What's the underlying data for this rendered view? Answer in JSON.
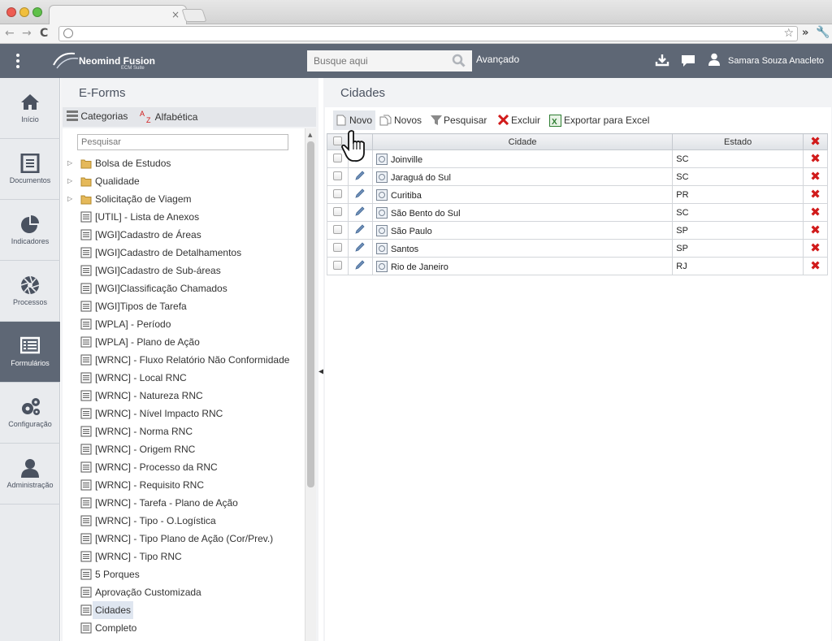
{
  "browser": {
    "tab_close": "×"
  },
  "header": {
    "logo_name": "Neomind Fusion",
    "logo_sub": "ECM Suite",
    "search_placeholder": "Busque aqui",
    "advanced_label": "Avançado",
    "user_name": "Samara Souza Anacleto"
  },
  "leftnav": {
    "items": [
      {
        "label": "Início",
        "icon": "home-icon"
      },
      {
        "label": "Documentos",
        "icon": "document-icon"
      },
      {
        "label": "Indicadores",
        "icon": "pie-chart-icon"
      },
      {
        "label": "Processos",
        "icon": "aperture-icon"
      },
      {
        "label": "Formulários",
        "icon": "form-icon",
        "active": true
      },
      {
        "label": "Configuração",
        "icon": "gears-icon"
      },
      {
        "label": "Administração",
        "icon": "user-icon"
      }
    ]
  },
  "eforms": {
    "title": "E-Forms",
    "tab_categorias": "Categorias",
    "tab_alfabetica": "Alfabética",
    "search_placeholder": "Pesquisar",
    "items": [
      {
        "label": "Bolsa de Estudos",
        "type": "folder"
      },
      {
        "label": "Qualidade",
        "type": "folder"
      },
      {
        "label": "Solicitação de Viagem",
        "type": "folder"
      },
      {
        "label": "[UTIL] - Lista de Anexos",
        "type": "form"
      },
      {
        "label": "[WGI]Cadastro de Áreas",
        "type": "form"
      },
      {
        "label": "[WGI]Cadastro de Detalhamentos",
        "type": "form"
      },
      {
        "label": "[WGI]Cadastro de Sub-áreas",
        "type": "form"
      },
      {
        "label": "[WGI]Classificação Chamados",
        "type": "form"
      },
      {
        "label": "[WGI]Tipos de Tarefa",
        "type": "form"
      },
      {
        "label": "[WPLA] - Período",
        "type": "form"
      },
      {
        "label": "[WPLA] - Plano de Ação",
        "type": "form"
      },
      {
        "label": "[WRNC] - Fluxo Relatório Não Conformidade",
        "type": "form"
      },
      {
        "label": "[WRNC] - Local RNC",
        "type": "form"
      },
      {
        "label": "[WRNC] - Natureza RNC",
        "type": "form"
      },
      {
        "label": "[WRNC] - Nível Impacto RNC",
        "type": "form"
      },
      {
        "label": "[WRNC] - Norma RNC",
        "type": "form"
      },
      {
        "label": "[WRNC] - Origem RNC",
        "type": "form"
      },
      {
        "label": "[WRNC] - Processo da RNC",
        "type": "form"
      },
      {
        "label": "[WRNC] - Requisito RNC",
        "type": "form"
      },
      {
        "label": "[WRNC] - Tarefa - Plano de Ação",
        "type": "form"
      },
      {
        "label": "[WRNC] - Tipo - O.Logística",
        "type": "form"
      },
      {
        "label": "[WRNC] - Tipo Plano de Ação (Cor/Prev.)",
        "type": "form"
      },
      {
        "label": "[WRNC] - Tipo RNC",
        "type": "form"
      },
      {
        "label": "5 Porques",
        "type": "form"
      },
      {
        "label": "Aprovação Customizada",
        "type": "form"
      },
      {
        "label": "Cidades",
        "type": "form",
        "selected": true
      },
      {
        "label": "Completo",
        "type": "form"
      }
    ]
  },
  "main": {
    "title": "Cidades",
    "toolbar": {
      "novo": "Novo",
      "novos": "Novos",
      "pesquisar": "Pesquisar",
      "excluir": "Excluir",
      "exportar": "Exportar para Excel"
    },
    "grid": {
      "col_cidade": "Cidade",
      "col_estado": "Estado",
      "rows": [
        {
          "cidade": "Joinville",
          "estado": "SC"
        },
        {
          "cidade": "Jaraguá do Sul",
          "estado": "SC"
        },
        {
          "cidade": "Curitiba",
          "estado": "PR"
        },
        {
          "cidade": "São Bento do Sul",
          "estado": "SC"
        },
        {
          "cidade": "São Paulo",
          "estado": "SP"
        },
        {
          "cidade": "Santos",
          "estado": "SP"
        },
        {
          "cidade": "Rio de Janeiro",
          "estado": "RJ"
        }
      ]
    }
  },
  "colors": {
    "header_bg": "#5e6775",
    "delete_red": "#d11b1b",
    "selected_bg": "#dfe6f0"
  }
}
